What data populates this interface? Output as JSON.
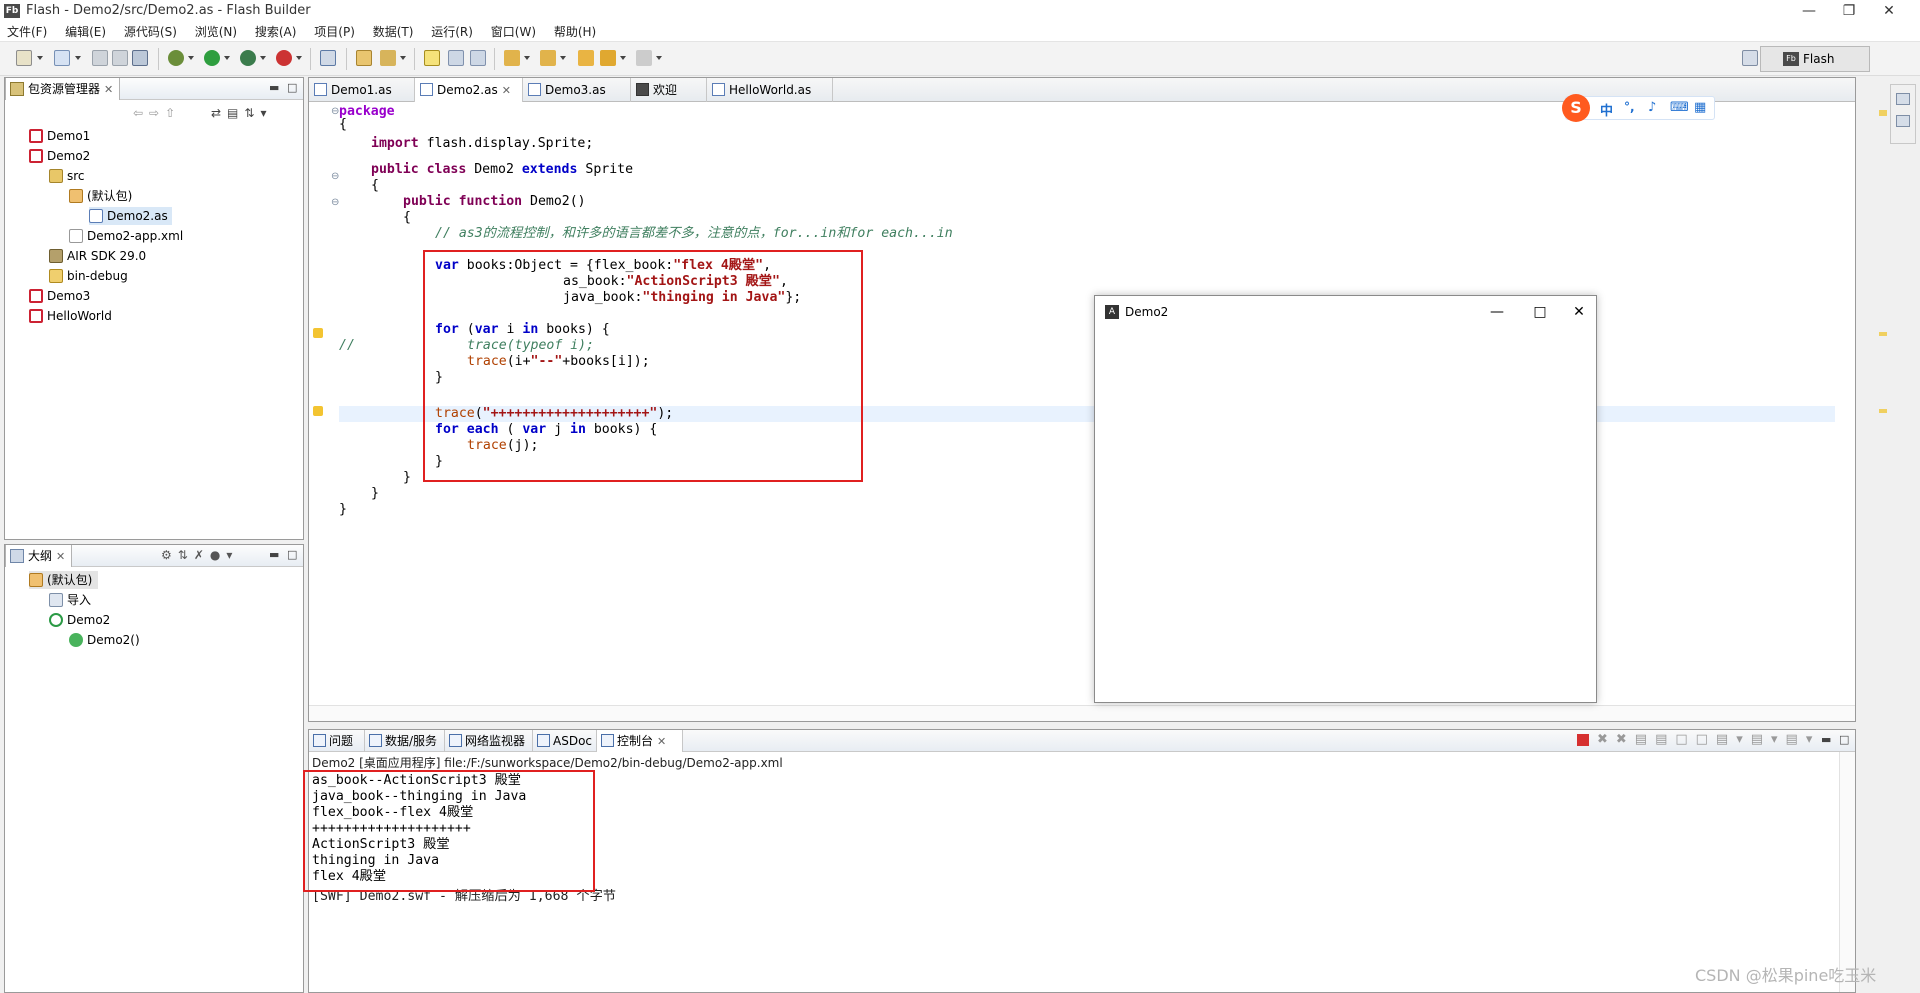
{
  "window": {
    "title": "Flash - Demo2/src/Demo2.as - Flash Builder",
    "icon": "Fb"
  },
  "menu": [
    "文件(F)",
    "编辑(E)",
    "源代码(S)",
    "浏览(N)",
    "搜索(A)",
    "项目(P)",
    "数据(T)",
    "运行(R)",
    "窗口(W)",
    "帮助(H)"
  ],
  "perspective": {
    "icon": "Fb",
    "label": "Flash"
  },
  "package_explorer": {
    "title": "包资源管理器",
    "items": [
      {
        "label": "Demo1"
      },
      {
        "label": "Demo2"
      },
      {
        "label": "src"
      },
      {
        "label": "(默认包)"
      },
      {
        "label": "Demo2.as"
      },
      {
        "label": "Demo2-app.xml"
      },
      {
        "label": "AIR SDK 29.0"
      },
      {
        "label": "bin-debug"
      },
      {
        "label": "Demo3"
      },
      {
        "label": "HelloWorld"
      }
    ]
  },
  "outline": {
    "title": "大纲",
    "items": [
      {
        "label": "(默认包)"
      },
      {
        "label": "导入"
      },
      {
        "label": "Demo2"
      },
      {
        "label": "Demo2()"
      }
    ]
  },
  "editor": {
    "tabs": [
      {
        "label": "Demo1.as"
      },
      {
        "label": "Demo2.as"
      },
      {
        "label": "Demo3.as"
      },
      {
        "label": "欢迎"
      },
      {
        "label": "HelloWorld.as"
      }
    ],
    "code": {
      "l1": "package",
      "l2": "{",
      "l3a": "import",
      "l3b": " flash.display.Sprite;",
      "l4a": "public",
      "l4b": " class",
      "l4c": " Demo2 ",
      "l4d": "extends",
      "l4e": " Sprite",
      "l5": "{",
      "l6a": "public",
      "l6b": " function",
      "l6c": " Demo2()",
      "l7": "{",
      "l8": "// as3的流程控制，和许多的语言都差不多，注意的点，for...in和for each...in",
      "l9a": "var",
      " l9b": " books:Object = {flex_book:",
      "l9c": "\"flex 4殿堂\"",
      "l9d": ",",
      "l10a": "as_book:",
      "l10b": "\"ActionScript3 殿堂\"",
      "l10c": ",",
      "l11a": "java_book:",
      "l11b": "\"thinging in Java\"",
      "l11c": "};",
      "l12a": "for",
      " l12b": " (",
      "l12c": "var",
      " l12d": " i ",
      "l12e": "in",
      " l12f": " books) {",
      "l13a": "//",
      "l13b": "trace(typeof i);",
      "l14a": "trace",
      "l14b": "(i+",
      "l14c": "\"--\"",
      "l14d": "+books[i]);",
      "l15": "}",
      "l16a": "trace",
      "l16b": "(",
      "l16c": "\"++++++++++++++++++++\"",
      "l16d": ");",
      "l17a": "for each",
      " l17b": " ( ",
      "l17c": "var",
      " l17d": " j ",
      "l17e": "in",
      " l17f": " books) {",
      "l18a": "trace",
      "l18b": "(j);",
      "l19": "}",
      "l20": "}",
      "l21": "}",
      "l22": "}"
    }
  },
  "app_window": {
    "title": "Demo2"
  },
  "ime": {
    "labels": [
      "中",
      "°,",
      "☷"
    ]
  },
  "console": {
    "tabs": [
      {
        "label": "问题"
      },
      {
        "label": "数据/服务"
      },
      {
        "label": "网络监视器"
      },
      {
        "label": "ASDoc"
      },
      {
        "label": "控制台"
      }
    ],
    "path": "Demo2 [桌面应用程序] file:/F:/sunworkspace/Demo2/bin-debug/Demo2-app.xml",
    "output": "as_book--ActionScript3 殿堂\njava_book--thinging in Java\nflex_book--flex 4殿堂\n++++++++++++++++++++\nActionScript3 殿堂\nthinging in Java\nflex 4殿堂",
    "swf": "[SWF] Demo2.swf - 解压缩后为 1,668 个字节"
  },
  "watermark": "CSDN @松果pine吃玉米"
}
